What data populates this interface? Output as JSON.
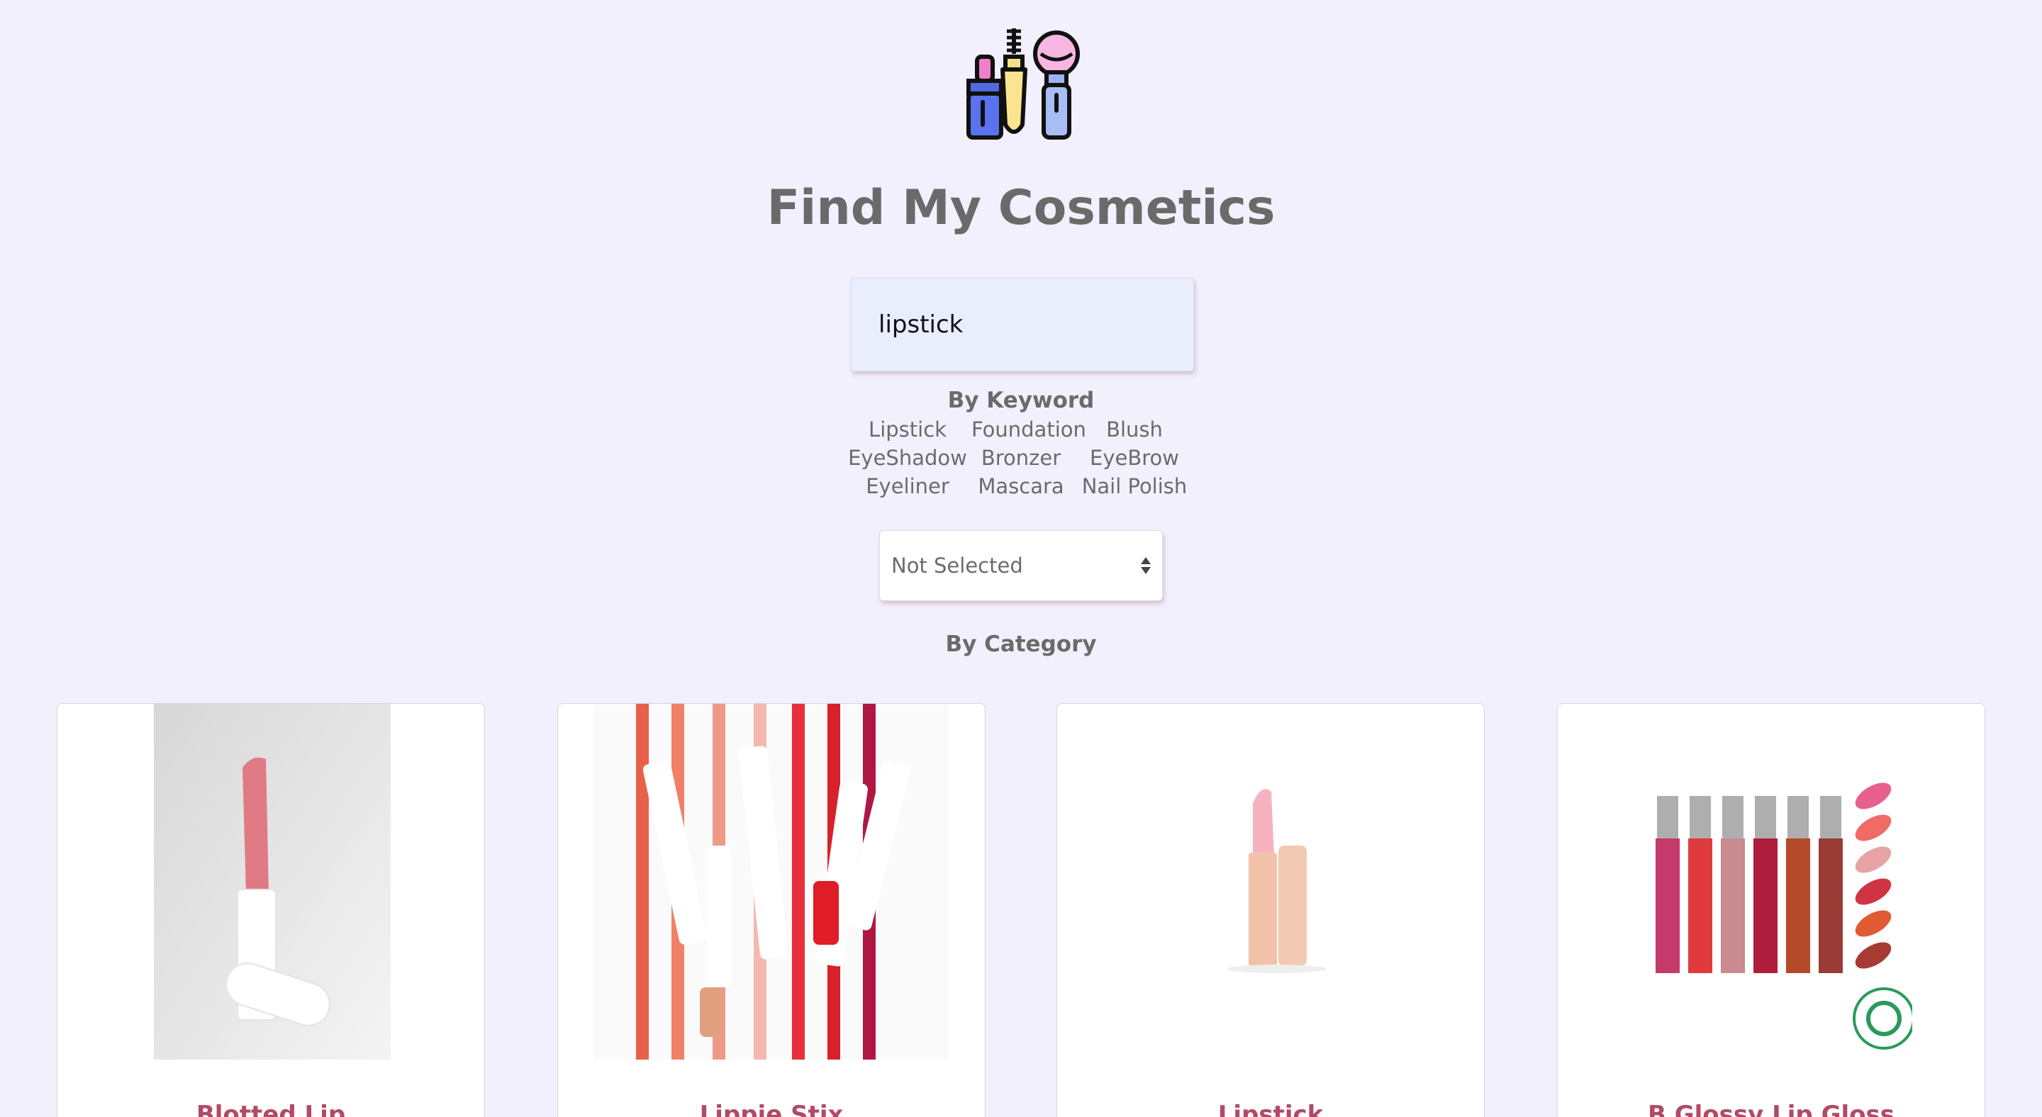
{
  "app": {
    "title": "Find My Cosmetics",
    "logo_icon": "makeup-kit-icon"
  },
  "search": {
    "value": "lipstick",
    "placeholder": ""
  },
  "keywords": {
    "heading": "By Keyword",
    "items": [
      "Lipstick",
      "Foundation",
      "Blush",
      "EyeShadow",
      "Bronzer",
      "EyeBrow",
      "Eyeliner",
      "Mascara",
      "Nail Polish"
    ]
  },
  "category": {
    "heading": "By Category",
    "selected": "Not Selected"
  },
  "products": [
    {
      "name": "Blotted Lip"
    },
    {
      "name": "Lippie Stix"
    },
    {
      "name": "Lipstick"
    },
    {
      "name": "B Glossy Lip Gloss"
    }
  ],
  "colors": {
    "background": "#f2f0fc",
    "search_bg": "#e8eefc",
    "product_name": "#b04a66",
    "text": "#6b6b6b"
  }
}
